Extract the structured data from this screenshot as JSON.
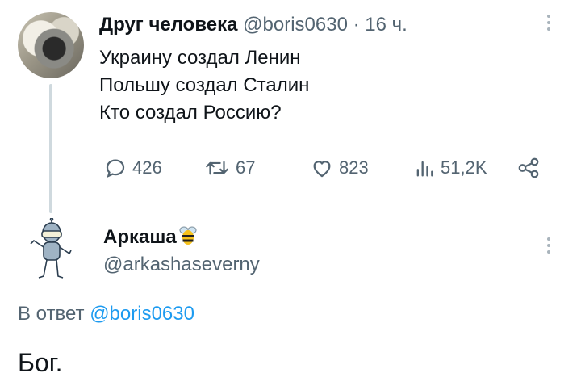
{
  "tweet1": {
    "display_name": "Друг человека",
    "handle": "@boris0630",
    "time": "· 16 ч.",
    "lines": [
      "Украину создал Ленин",
      "Польшу создал Сталин",
      "Кто создал Россию?"
    ],
    "replies": "426",
    "retweets": "67",
    "likes": "823",
    "views": "51,2K",
    "icons": [
      "reply-icon",
      "retweet-icon",
      "like-icon",
      "views-icon",
      "share-icon",
      "more-icon"
    ]
  },
  "tweet2": {
    "display_name": "Аркаша",
    "badge_icon": "bee-icon",
    "handle": "@arkashaseverny",
    "reply_prefix": "В ответ",
    "reply_to": "@boris0630",
    "text": "Бог."
  },
  "colors": {
    "accent": "#1d9bf0",
    "secondary": "#536471",
    "text": "#0f1419",
    "thread_line": "#cfd9de"
  }
}
